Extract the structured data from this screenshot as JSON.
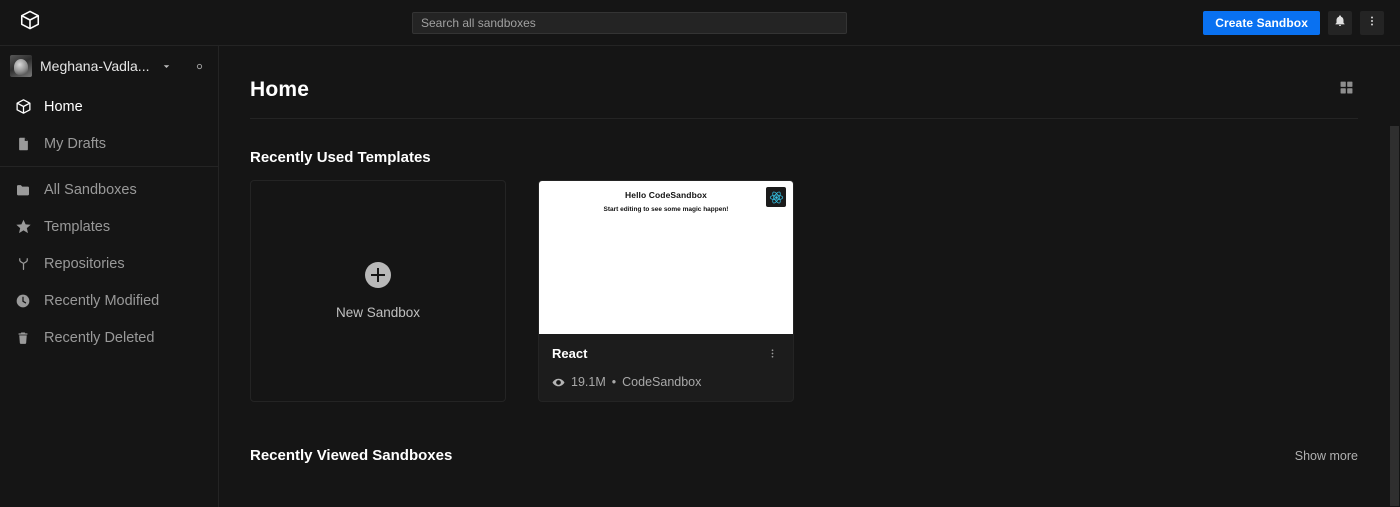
{
  "header": {
    "logo_icon": "codesandbox-cube-icon",
    "search": {
      "placeholder": "Search all sandboxes",
      "value": ""
    },
    "create_button": "Create Sandbox",
    "notifications_icon": "bell-icon",
    "overflow_icon": "more-vertical-icon",
    "accent_color": "#0971f1"
  },
  "sidebar": {
    "user": {
      "name": "Meghana-Vadla...",
      "avatar_icon": "user-avatar",
      "chevron_icon": "chevron-down-icon",
      "settings_icon": "gear-icon"
    },
    "items": [
      {
        "label": "Home",
        "icon": "cube-icon",
        "active": true
      },
      {
        "label": "My Drafts",
        "icon": "document-icon",
        "active": false
      },
      {
        "label": "All Sandboxes",
        "icon": "folder-icon",
        "active": false
      },
      {
        "label": "Templates",
        "icon": "star-icon",
        "active": false
      },
      {
        "label": "Repositories",
        "icon": "branch-icon",
        "active": false
      },
      {
        "label": "Recently Modified",
        "icon": "clock-icon",
        "active": false
      },
      {
        "label": "Recently Deleted",
        "icon": "trash-icon",
        "active": false
      }
    ]
  },
  "main": {
    "page_title": "Home",
    "view_toggle_icon": "grid-view-icon",
    "templates_section": {
      "title": "Recently Used Templates",
      "new_sandbox": {
        "label": "New Sandbox",
        "icon": "plus-circle-icon"
      },
      "cards": [
        {
          "title": "React",
          "views": "19.1M",
          "separator": "•",
          "author": "CodeSandbox",
          "views_icon": "eye-icon",
          "menu_icon": "more-vertical-icon",
          "badge_icon": "react-logo-icon",
          "preview_heading": "Hello CodeSandbox",
          "preview_subheading": "Start editing to see some magic happen!"
        }
      ]
    },
    "recent_section": {
      "title": "Recently Viewed Sandboxes",
      "show_more": "Show more"
    }
  }
}
